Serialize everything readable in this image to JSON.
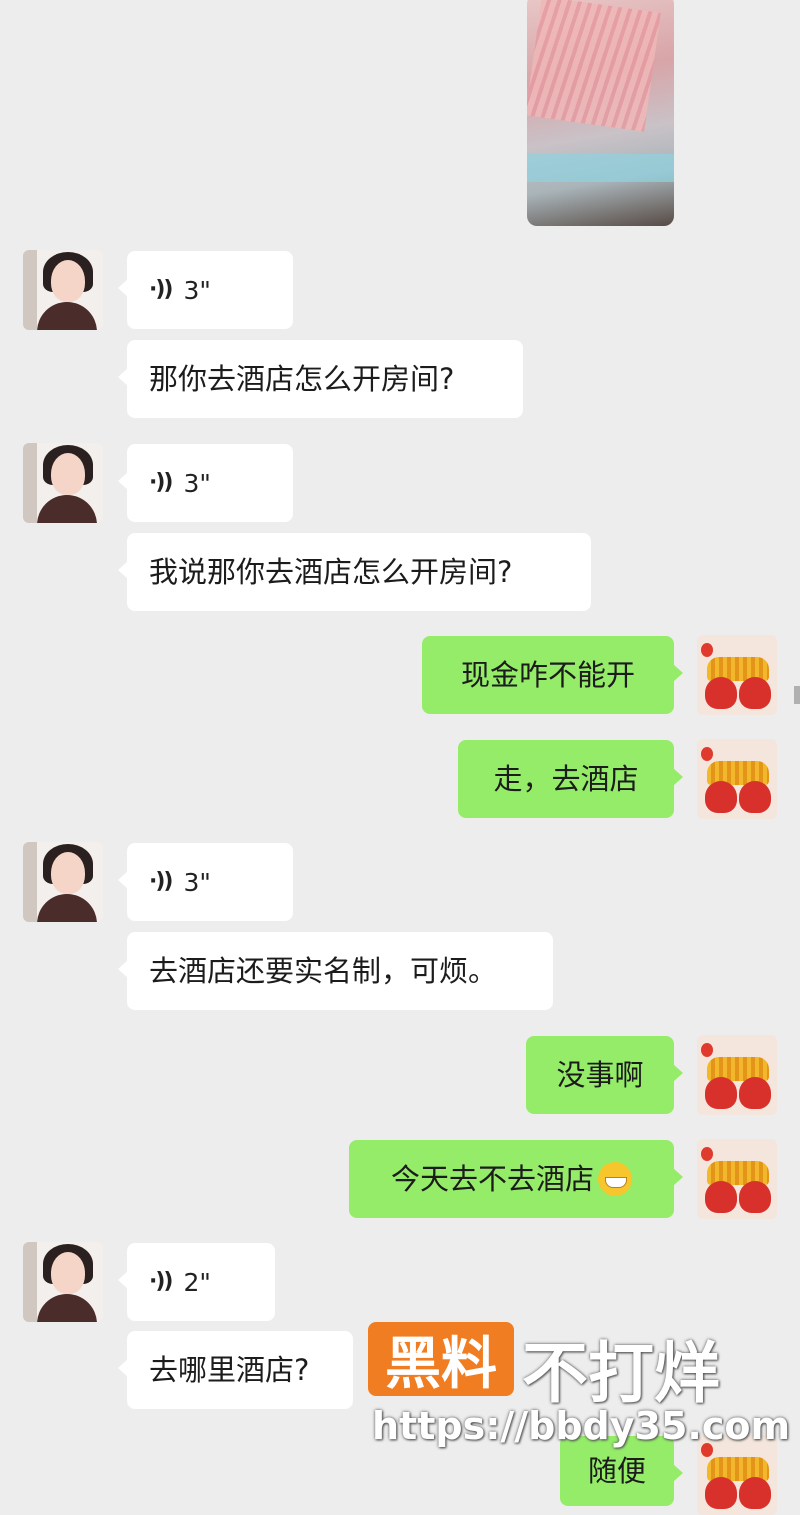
{
  "messages": [
    {
      "voice_duration": "3\""
    },
    {
      "text": "那你去酒店怎么开房间?"
    },
    {
      "voice_duration": "3\""
    },
    {
      "text": "我说那你去酒店怎么开房间?"
    },
    {
      "text": "现金咋不能开"
    },
    {
      "text": "走，去酒店"
    },
    {
      "voice_duration": "3\""
    },
    {
      "text": "去酒店还要实名制，可烦。"
    },
    {
      "text": "没事啊"
    },
    {
      "text": "今天去不去酒店"
    },
    {
      "voice_duration": "2\""
    },
    {
      "text": "去哪里酒店?"
    },
    {
      "text": "随便"
    }
  ],
  "watermark": {
    "badge": "黑料",
    "title": "不打烊",
    "url": "https://bbdy35.com"
  },
  "icons": {
    "voice": "voice-wave-icon",
    "emoji": "grinning-face-icon"
  }
}
